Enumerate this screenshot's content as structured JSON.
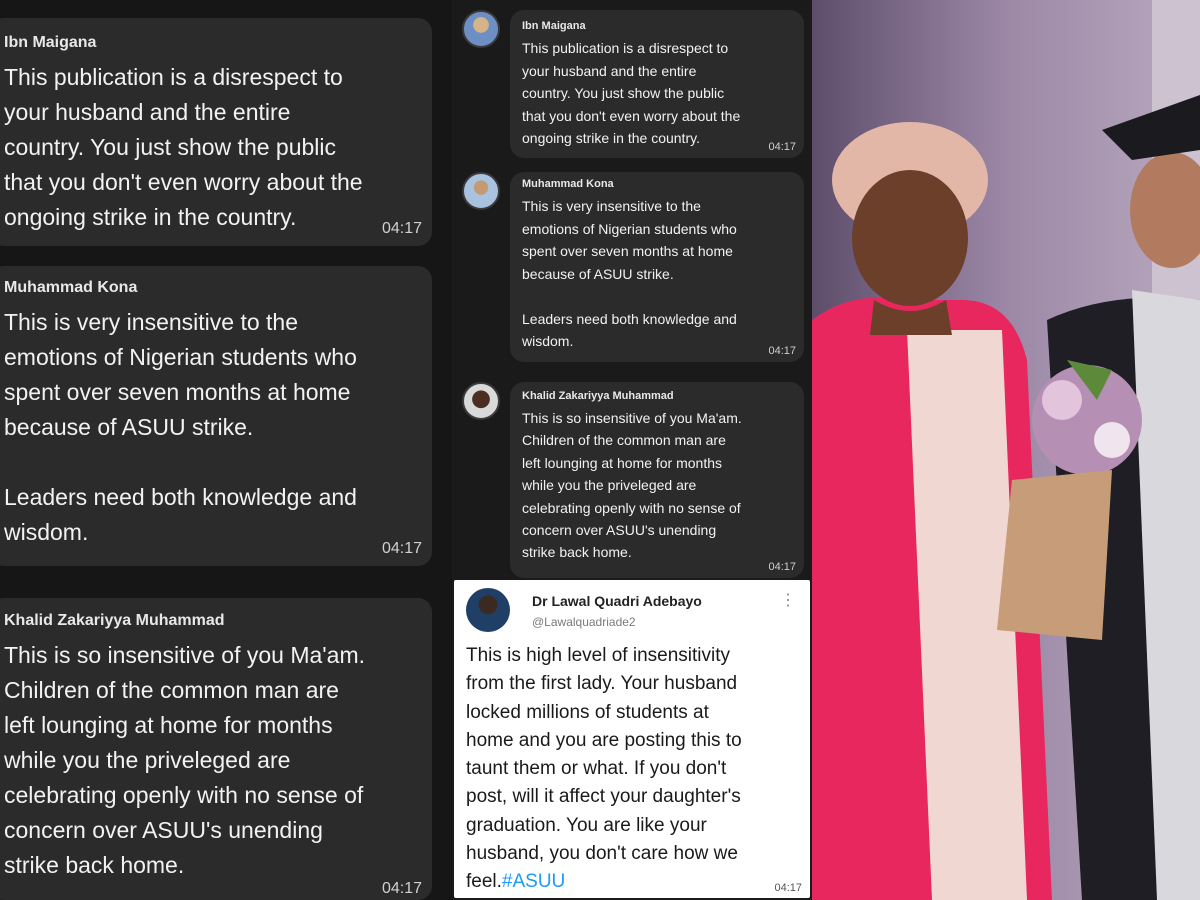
{
  "comments_large": [
    {
      "author": "Ibn Maigana",
      "text": "This publication is a disrespect to\nyour husband and the entire\ncountry. You just show the public\nthat you don't even worry about the\nongoing strike in the country.",
      "time": "04:17"
    },
    {
      "author": "Muhammad Kona",
      "text": "This is very insensitive to the\nemotions of Nigerian students who\nspent over seven months at home\nbecause of ASUU strike.\n\nLeaders need both knowledge and\nwisdom.",
      "time": "04:17"
    },
    {
      "author": "Khalid Zakariyya Muhammad",
      "text": "This is so insensitive of you Ma'am.\nChildren of the common man are\nleft lounging at home for months\nwhile you the priveleged are\ncelebrating openly with no sense of\nconcern over ASUU's unending\nstrike back home.",
      "time": "04:17"
    }
  ],
  "comments_small": [
    {
      "author": "Ibn Maigana",
      "text": "This publication is a disrespect to\nyour husband and the entire\ncountry. You just show the public\nthat you don't even worry about the\nongoing strike in the country.",
      "time": "04:17"
    },
    {
      "author": "Muhammad Kona",
      "text": "This is very insensitive to the\nemotions of Nigerian students who\nspent over seven months at home\nbecause of ASUU strike.\n\nLeaders need both knowledge and\nwisdom.",
      "time": "04:17"
    },
    {
      "author": "Khalid Zakariyya Muhammad",
      "text": "This is so insensitive of you Ma'am.\nChildren of the common man are\nleft lounging at home for months\nwhile you the priveleged are\ncelebrating openly with no sense of\nconcern over ASUU's unending\nstrike back home.",
      "time": "04:17"
    }
  ],
  "tweet": {
    "name": "Dr Lawal Quadri Adebayo",
    "handle": "@Lawalquadriade2",
    "more_icon": "more-options-icon",
    "text": "This is high level of insensitivity\nfrom the first lady. Your husband\nlocked millions of students at\nhome and you are posting this to\ntaunt them or what. If you don't\npost, will it affect your daughter's\ngraduation. You are like your\nhusband, you don't care how we\nfeel.",
    "hashtag": "#ASUU",
    "time": "04:17"
  },
  "colors": {
    "bubble": "#2b2b2b",
    "hashtag": "#1d9bf0",
    "pink_wrap": "#e8275f"
  }
}
